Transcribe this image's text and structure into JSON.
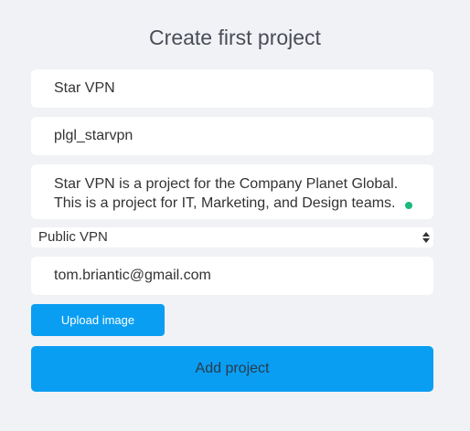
{
  "form": {
    "title": "Create first project",
    "project_name": "Star VPN",
    "project_slug": "plgl_starvpn",
    "description_lines": [
      "Star VPN is a project for the Company Planet Global.",
      "This is a project for IT, Marketing, and Design teams."
    ],
    "visibility_selected": "Public VPN",
    "email": "tom.briantic@gmail.com",
    "upload_label": "Upload image",
    "submit_label": "Add project"
  },
  "colors": {
    "background": "#f1f2f6",
    "accent": "#0a9ef2",
    "status_dot": "#1bb97c"
  },
  "icons": {
    "select_arrows": "up-down-arrows-icon",
    "status": "status-dot-icon"
  }
}
